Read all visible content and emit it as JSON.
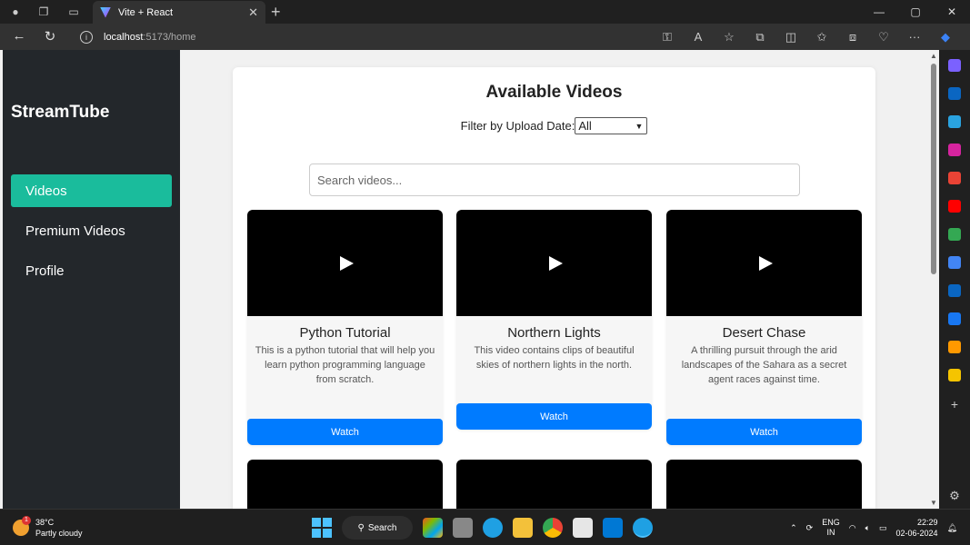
{
  "browser": {
    "tab_title": "Vite + React",
    "tab_close": "✕",
    "new_tab": "+",
    "url_host": "localhost",
    "url_path": ":5173/home",
    "window_controls": [
      "—",
      "▢",
      "✕"
    ]
  },
  "sidebar": {
    "brand": "StreamTube",
    "items": [
      {
        "label": "Videos",
        "active": true
      },
      {
        "label": "Premium Videos",
        "active": false
      },
      {
        "label": "Profile",
        "active": false
      }
    ]
  },
  "main": {
    "title": "Available Videos",
    "filter_label": "Filter by Upload Date:",
    "filter_value": "All",
    "search_placeholder": "Search videos...",
    "videos": [
      {
        "title": "Python Tutorial",
        "description": "This is a python tutorial that will help you learn python programming language from scratch.",
        "button": "Watch"
      },
      {
        "title": "Northern Lights",
        "description": "This video contains clips of beautiful skies of northern lights in the north.",
        "button": "Watch"
      },
      {
        "title": "Desert Chase",
        "description": "A thrilling pursuit through the arid landscapes of the Sahara as a secret agent races against time.",
        "button": "Watch"
      }
    ]
  },
  "taskbar": {
    "temperature": "38°C",
    "weather": "Partly cloudy",
    "weather_badge": "1",
    "search_label": "Search",
    "lang_top": "ENG",
    "lang_bottom": "IN",
    "time": "22:29",
    "date": "02-06-2024"
  },
  "colors": {
    "accent_active": "#1abc9c",
    "button_blue": "#007bff",
    "sidebar_bg": "#23272b"
  }
}
